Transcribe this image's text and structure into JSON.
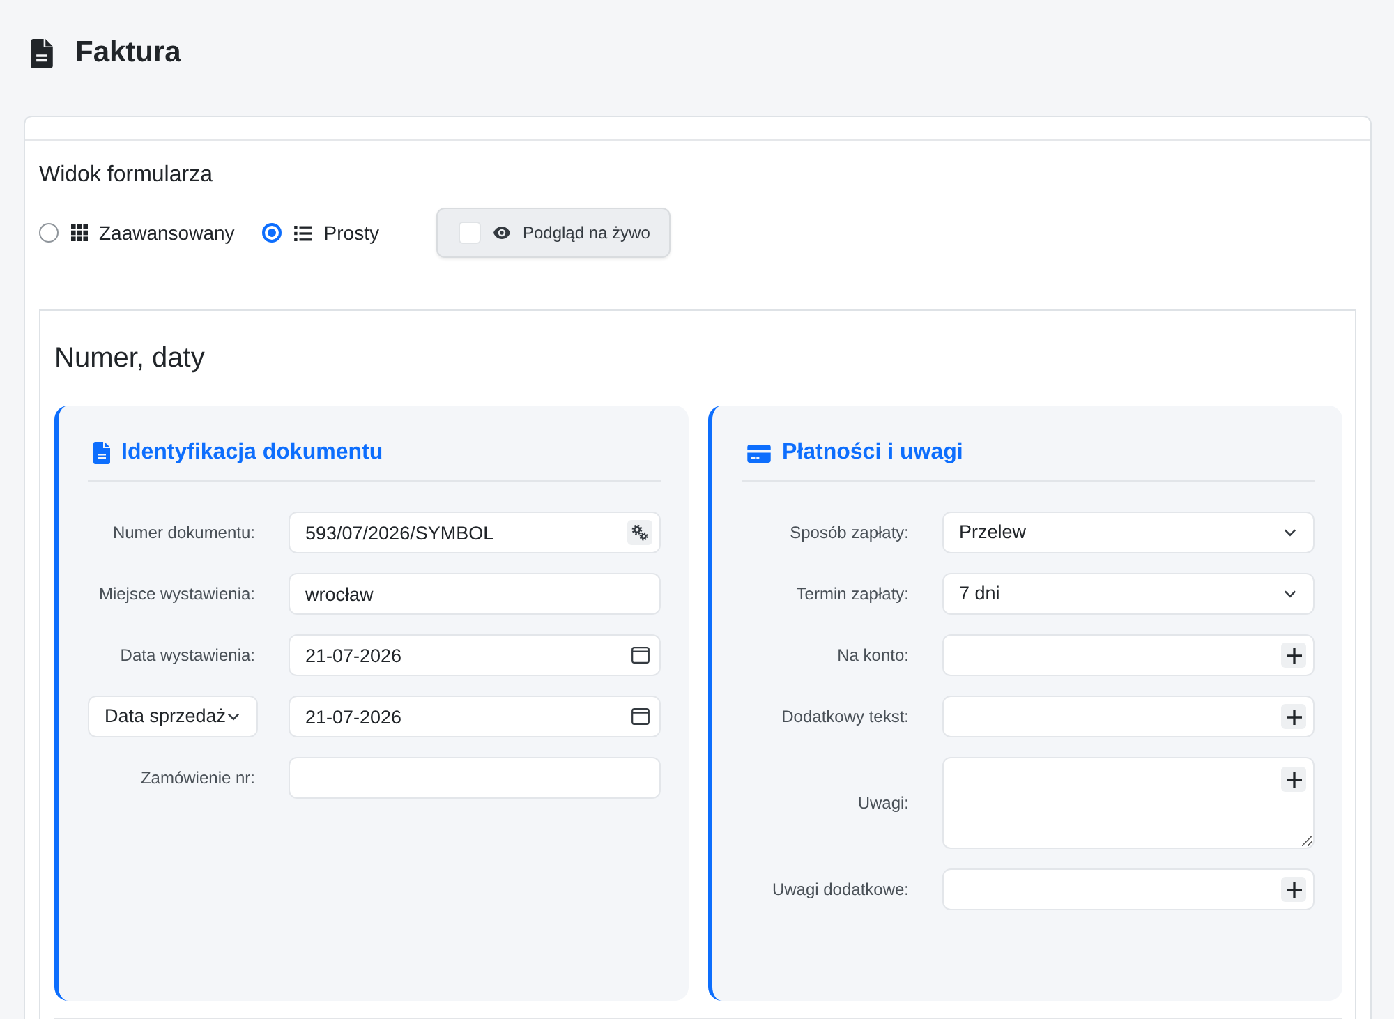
{
  "page": {
    "title": "Faktura"
  },
  "form_view": {
    "title": "Widok formularza",
    "options": [
      {
        "label": "Zaawansowany",
        "kind": "grid",
        "selected": false
      },
      {
        "label": "Prosty",
        "kind": "list",
        "selected": true
      }
    ],
    "live_preview": {
      "label": "Podgląd na żywo",
      "checked": false
    }
  },
  "section": {
    "title": "Numer, daty",
    "panels": [
      {
        "title": "Identyfikacja dokumentu",
        "kind": "document",
        "fields": [
          {
            "label": "Numer dokumentu:",
            "kind": "text",
            "value": "593/07/2026/SYMBOL",
            "generate_button": true
          },
          {
            "label": "Miejsce wystawienia:",
            "kind": "text",
            "value": "wrocław"
          },
          {
            "label": "Data wystawienia:",
            "kind": "date",
            "value": "21-07-2026"
          },
          {
            "label_dropdown": "Data sprzedaż",
            "kind": "date",
            "value": "21-07-2026"
          },
          {
            "label": "Zamówienie nr:",
            "kind": "text"
          }
        ]
      },
      {
        "title": "Płatności i uwagi",
        "kind": "card",
        "fields": [
          {
            "label": "Sposób zapłaty:",
            "kind": "select",
            "value": "Przelew"
          },
          {
            "label": "Termin zapłaty:",
            "kind": "select",
            "value": "7 dni"
          },
          {
            "label": "Na konto:",
            "kind": "text",
            "add_button": true
          },
          {
            "label": "Dodatkowy tekst:",
            "kind": "text",
            "add_button": true
          },
          {
            "label": "Uwagi:",
            "kind": "textarea",
            "add_button": true
          },
          {
            "label": "Uwagi dodatkowe:",
            "kind": "text",
            "add_button": true
          }
        ]
      }
    ]
  }
}
